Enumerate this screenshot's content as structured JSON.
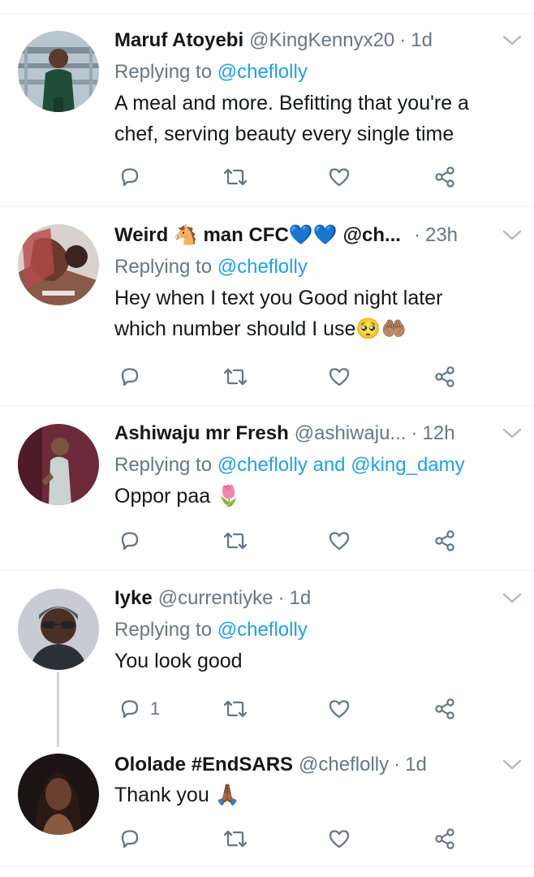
{
  "tweets": [
    {
      "name": "Maruf Atoyebi",
      "handle": "@KingKennyx20",
      "time": "1d",
      "replying_prefix": "Replying to",
      "mentions": "@cheflolly",
      "lines": [
        "A meal and more. Befitting that you're a",
        "chef, serving beauty every single time"
      ],
      "reply_count": ""
    },
    {
      "name": "Weird 🐴 man CFC💙💙",
      "handle": "@ch...",
      "time": "23h",
      "replying_prefix": "Replying to",
      "mentions": "@cheflolly",
      "lines": [
        "Hey when I text you Good night later",
        "which number should I use🥺🤲🏽"
      ],
      "reply_count": ""
    },
    {
      "name": "Ashiwaju mr Fresh",
      "handle": "@ashiwaju...",
      "time": "12h",
      "replying_prefix": "Replying to",
      "mentions": "@cheflolly and @king_damy",
      "lines": [
        "Oppor paa 🌷"
      ],
      "reply_count": ""
    },
    {
      "name": "Iyke",
      "handle": "@currentiyke",
      "time": "1d",
      "replying_prefix": "Replying to",
      "mentions": "@cheflolly",
      "lines": [
        "You look good"
      ],
      "reply_count": "1"
    },
    {
      "name": "Ololade #EndSARS",
      "handle": "@cheflolly",
      "time": "1d",
      "replying_prefix": "",
      "mentions": "",
      "lines": [
        "Thank you 🙏🏾"
      ],
      "reply_count": ""
    }
  ],
  "icons": {
    "reply": "reply-icon",
    "retweet": "retweet-icon",
    "like": "heart-icon",
    "share": "share-icon",
    "more": "chevron-down-icon"
  },
  "colors": {
    "text": "#14171a",
    "muted": "#657786",
    "accent": "#1da1f2",
    "separator": "#e6ecf0",
    "icon": "#657786"
  }
}
